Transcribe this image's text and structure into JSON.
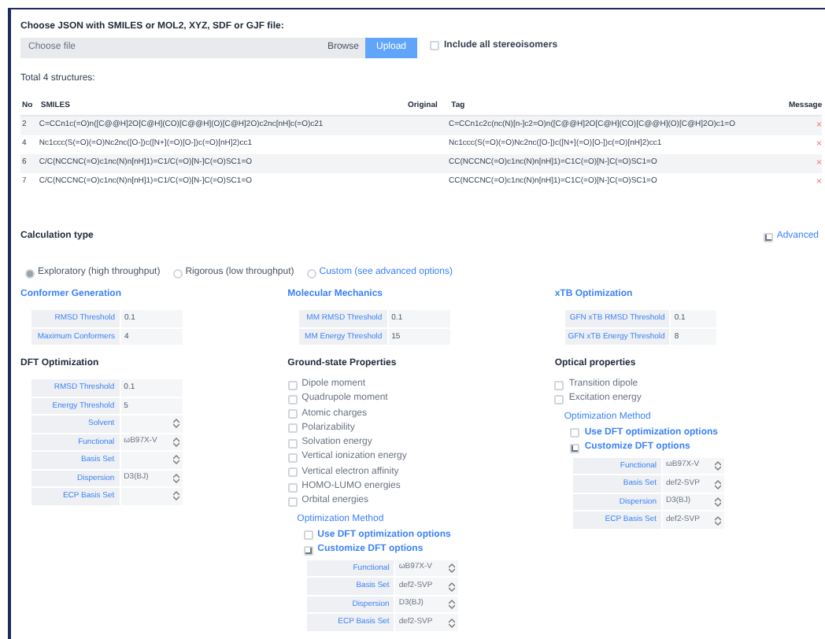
{
  "upload": {
    "label": "Choose JSON with SMILES or MOL2, XYZ, SDF or GJF file:",
    "placeholder": "Choose file",
    "browse": "Browse",
    "upload": "Upload",
    "stereo": {
      "label": "Include all stereoisomers",
      "checked": false
    }
  },
  "total": "Total 4 structures:",
  "table": {
    "columns": [
      "No",
      "SMILES",
      "Original",
      "Tag",
      "Message"
    ],
    "rows": [
      {
        "no": "2",
        "smiles": "C=CCn1c(=O)n([C@@H]2O[C@H](CO)[C@@H](O)[C@H]2O)c2nc[nH]c(=O)c21",
        "tag": "C=CCn1c2c(nc(N)[n-]c2=O)n([C@@H]2O[C@H](CO)[C@@H](O)[C@H]2O)c1=O",
        "delete": "×"
      },
      {
        "no": "4",
        "smiles": "Nc1ccc(S(=O)(=O)Nc2nc([O-])c([N+](=O)[O-])c(=O)[nH]2)cc1",
        "tag": "Nc1ccc(S(=O)(=O)Nc2nc([O-])c([N+](=O)[O-])c(=O)[nH]2)cc1",
        "delete": "×"
      },
      {
        "no": "6",
        "smiles": "C/C(NCCNC(=O)c1nc(N)n[nH]1)=C1/C(=O)[N-]C(=O)SC1=O",
        "tag": "CC(NCCNC(=O)c1nc(N)n[nH]1)=C1C(=O)[N-]C(=O)SC1=O",
        "delete": "×"
      },
      {
        "no": "7",
        "smiles": "C/C(NCCNC(=O)c1nc(N)n[nH]1)=C1/C(=O)[N-]C(=O)SC1=O",
        "tag": "CC(NCCNC(=O)c1nc(N)n[nH]1)=C1C(=O)[N-]C(=O)SC1=O",
        "delete": "×"
      }
    ]
  },
  "calc": {
    "title": "Calculation type",
    "advanced": {
      "label": "Advanced",
      "checked": true
    },
    "options": [
      {
        "label": "Exploratory (high throughput)",
        "selected": true,
        "kind": "plain"
      },
      {
        "label": "Rigorous (low throughput)",
        "selected": false,
        "kind": "plain"
      },
      {
        "label": "Custom (see advanced options)",
        "selected": false,
        "kind": "link"
      }
    ]
  },
  "conformer": {
    "title": "Conformer Generation",
    "fields": [
      {
        "label": "RMSD Threshold",
        "value": "0.1"
      },
      {
        "label": "Maximum Conformers",
        "value": "4"
      }
    ]
  },
  "mm": {
    "title": "Molecular Mechanics",
    "fields": [
      {
        "label": "MM RMSD Threshold",
        "value": "0.1"
      },
      {
        "label": "MM Energy Threshold",
        "value": "15"
      }
    ]
  },
  "xtb": {
    "title": "xTB Optimization",
    "fields": [
      {
        "label": "GFN xTB RMSD Threshold",
        "value": "0.1"
      },
      {
        "label": "GFN xTB Energy Threshold",
        "value": "8"
      }
    ]
  },
  "dft": {
    "title": "DFT Optimization",
    "fields": [
      {
        "label": "RMSD Threshold",
        "value": "0.1",
        "kind": "text"
      },
      {
        "label": "Energy Threshold",
        "value": "5",
        "kind": "text"
      },
      {
        "label": "Solvent",
        "kind": "select"
      },
      {
        "label": "Functional",
        "value": "ωB97X-V",
        "kind": "select"
      },
      {
        "label": "Basis Set",
        "kind": "select"
      },
      {
        "label": "Dispersion",
        "value": "D3(BJ)",
        "kind": "select"
      },
      {
        "label": "ECP Basis Set",
        "kind": "select"
      }
    ]
  },
  "ground": {
    "title": "Ground-state Properties",
    "checks": [
      {
        "label": "Dipole moment",
        "checked": false
      },
      {
        "label": "Quadrupole moment",
        "checked": false
      },
      {
        "label": "Atomic charges",
        "checked": false
      },
      {
        "label": "Polarizability",
        "checked": false
      },
      {
        "label": "Solvation energy",
        "checked": false
      },
      {
        "label": "Vertical ionization energy",
        "checked": false
      },
      {
        "label": "Vertical electron affinity",
        "checked": false
      },
      {
        "label": "HOMO-LUMO energies",
        "checked": false
      },
      {
        "label": "Orbital energies",
        "checked": false
      }
    ],
    "method": {
      "title": "Optimization Method",
      "options": [
        {
          "label": "Use DFT optimization options",
          "selected": false
        },
        {
          "label": "Customize DFT options",
          "selected": true
        }
      ],
      "fields": [
        {
          "label": "Functional",
          "value": "ωB97X-V",
          "kind": "select"
        },
        {
          "label": "Basis Set",
          "value": "def2-SVP",
          "kind": "select"
        },
        {
          "label": "Dispersion",
          "value": "D3(BJ)",
          "kind": "select"
        },
        {
          "label": "ECP Basis Set",
          "value": "def2-SVP",
          "kind": "select"
        }
      ]
    }
  },
  "optical": {
    "title": "Optical properties",
    "checks": [
      {
        "label": "Transition dipole",
        "checked": false
      },
      {
        "label": "Excitation energy",
        "checked": false
      }
    ],
    "method": {
      "title": "Optimization Method",
      "options": [
        {
          "label": "Use DFT optimization options",
          "selected": false
        },
        {
          "label": "Customize DFT options",
          "selected": true
        }
      ],
      "fields": [
        {
          "label": "Functional",
          "value": "ωB97X-V",
          "kind": "select"
        },
        {
          "label": "Basis Set",
          "value": "def2-SVP",
          "kind": "select"
        },
        {
          "label": "Dispersion",
          "value": "D3(BJ)",
          "kind": "select"
        },
        {
          "label": "ECP Basis Set",
          "value": "def2-SVP",
          "kind": "select"
        }
      ]
    }
  }
}
